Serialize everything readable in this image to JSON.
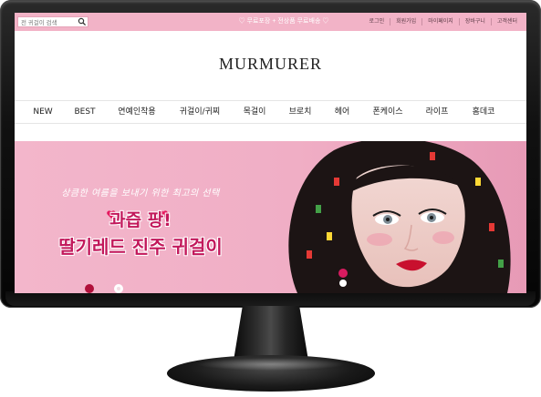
{
  "topbar": {
    "search": {
      "value": "전 귀걸이 검색"
    },
    "promo": "♡ 무료포장 + 전상품 무료배송 ♡",
    "links": [
      "로그인",
      "회원가입",
      "마이페이지",
      "장바구니",
      "고객센터"
    ]
  },
  "logo": "MURMURER",
  "nav": [
    "NEW",
    "BEST",
    "연예인착용",
    "귀걸이/귀찌",
    "목걸이",
    "브로치",
    "헤어",
    "폰케이스",
    "라이프",
    "홈데코"
  ],
  "hero": {
    "subtitle": "상큼한 여름을 보내기 위한 최고의 선택",
    "title_line1": "과즙 팡!",
    "title_line2": "딸기레드 진주 귀걸이"
  },
  "colors": {
    "topbar": "#f2b3c7",
    "hero_bg": "#f0aec5",
    "title": "#c2185b",
    "bezel": "#111111"
  }
}
